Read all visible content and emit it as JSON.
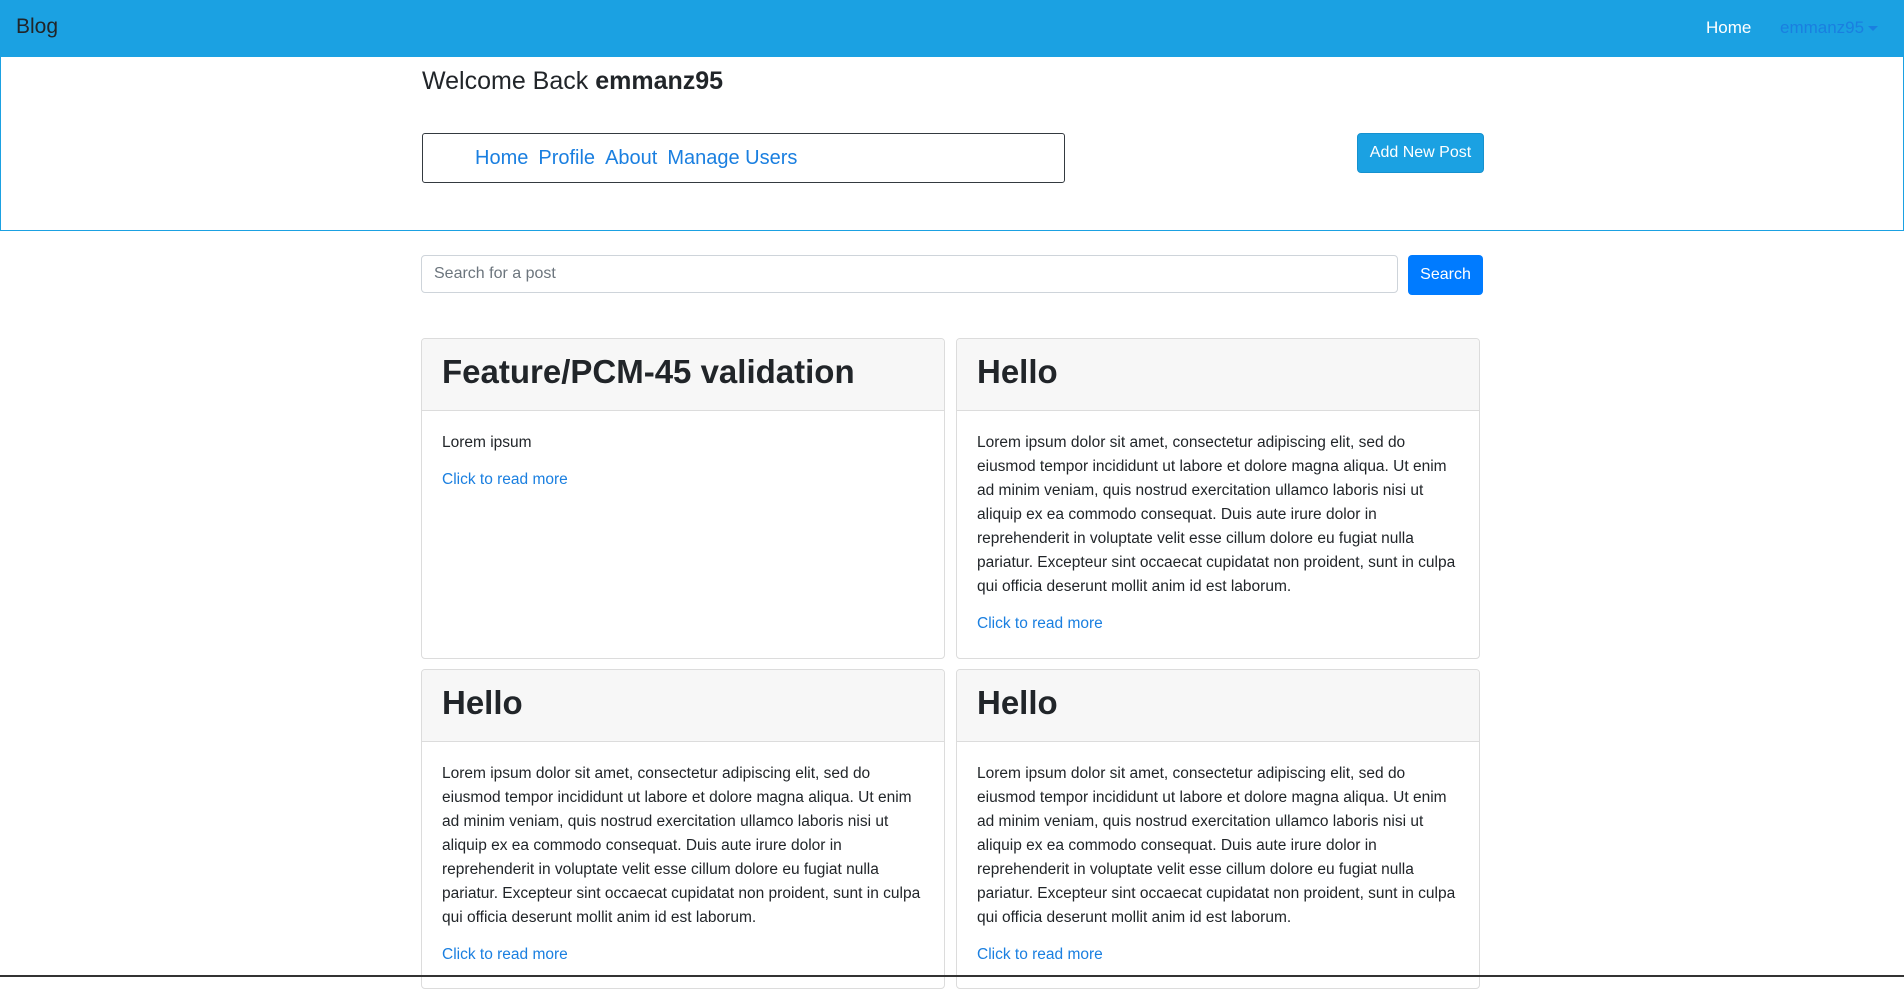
{
  "navbar": {
    "brand": "Blog",
    "home": "Home",
    "user": "emmanz95"
  },
  "header": {
    "welcome_prefix": "Welcome Back ",
    "username": "emmanz95",
    "subnav": [
      "Home",
      "Profile",
      "About",
      "Manage Users"
    ],
    "add_post_label": "Add New Post"
  },
  "search": {
    "placeholder": "Search for a post",
    "button_label": "Search"
  },
  "posts": [
    {
      "title": "Feature/PCM-45 validation",
      "body": "Lorem ipsum",
      "link": "Click to read more"
    },
    {
      "title": "Hello",
      "body": "Lorem ipsum dolor sit amet, consectetur adipiscing elit, sed do eiusmod tempor incididunt ut labore et dolore magna aliqua. Ut enim ad minim veniam, quis nostrud exercitation ullamco laboris nisi ut aliquip ex ea commodo consequat. Duis aute irure dolor in reprehenderit in voluptate velit esse cillum dolore eu fugiat nulla pariatur. Excepteur sint occaecat cupidatat non proident, sunt in culpa qui officia deserunt mollit anim id est laborum.",
      "link": "Click to read more"
    },
    {
      "title": "Hello",
      "body": "Lorem ipsum dolor sit amet, consectetur adipiscing elit, sed do eiusmod tempor incididunt ut labore et dolore magna aliqua. Ut enim ad minim veniam, quis nostrud exercitation ullamco laboris nisi ut aliquip ex ea commodo consequat. Duis aute irure dolor in reprehenderit in voluptate velit esse cillum dolore eu fugiat nulla pariatur. Excepteur sint occaecat cupidatat non proident, sunt in culpa qui officia deserunt mollit anim id est laborum.",
      "link": "Click to read more"
    },
    {
      "title": "Hello",
      "body": "Lorem ipsum dolor sit amet, consectetur adipiscing elit, sed do eiusmod tempor incididunt ut labore et dolore magna aliqua. Ut enim ad minim veniam, quis nostrud exercitation ullamco laboris nisi ut aliquip ex ea commodo consequat. Duis aute irure dolor in reprehenderit in voluptate velit esse cillum dolore eu fugiat nulla pariatur. Excepteur sint occaecat cupidatat non proident, sunt in culpa qui officia deserunt mollit anim id est laborum.",
      "link": "Click to read more"
    }
  ],
  "colors": {
    "navbar": "#1ba1e2",
    "link": "#1a7fe0",
    "search_button": "#007bff"
  }
}
